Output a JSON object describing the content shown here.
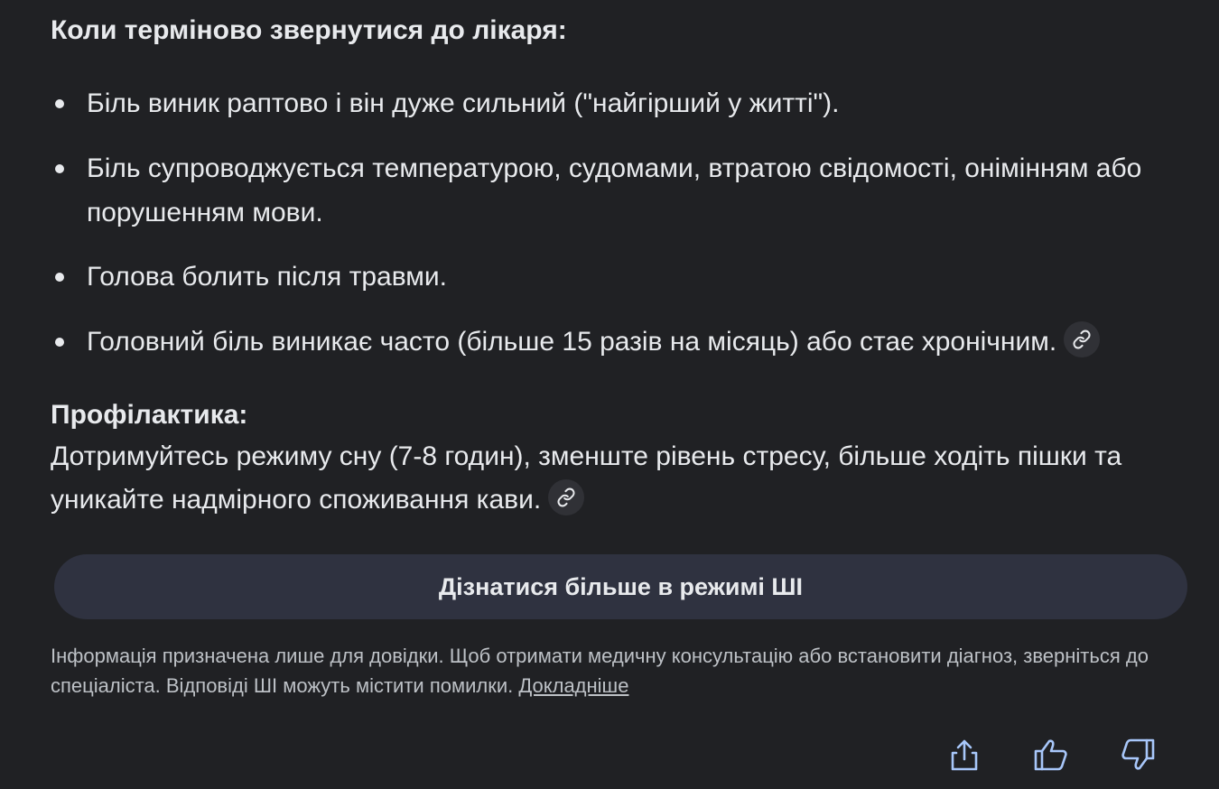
{
  "urgent": {
    "heading": "Коли терміново звернутися до лікаря:",
    "items": [
      "Біль виник раптово і він дуже сильний (\"найгірший у житті\").",
      "Біль супроводжується температурою, судомами, втратою свідомості, онімінням або порушенням мови.",
      "Голова болить після травми.",
      "Головний біль виникає часто (більше 15 разів на місяць) або стає хронічним."
    ]
  },
  "prevention": {
    "heading": "Профілактика:",
    "text": "Дотримуйтесь режиму сну (7-8 годин), зменште рівень стресу, більше ходіть пішки та уникайте надмірного споживання кави."
  },
  "more_button": {
    "label": "Дізнатися більше в режимі ШІ"
  },
  "disclaimer": {
    "text": "Інформація призначена лише для довідки. Щоб отримати медичну консультацію або встановити діагноз, зверніться до спеціаліста. Відповіді ШІ можуть містити помилки. ",
    "link_label": "Докладніше"
  },
  "icons": {
    "link": "link-icon",
    "share": "share-icon",
    "thumbs_up": "thumbs-up-icon",
    "thumbs_down": "thumbs-down-icon"
  },
  "colors": {
    "background": "#202124",
    "text": "#e8eaed",
    "muted_text": "#bdc1c6",
    "button_bg": "#2f3240",
    "icon_accent": "#a8c7fa",
    "chip_bg": "#303136"
  }
}
